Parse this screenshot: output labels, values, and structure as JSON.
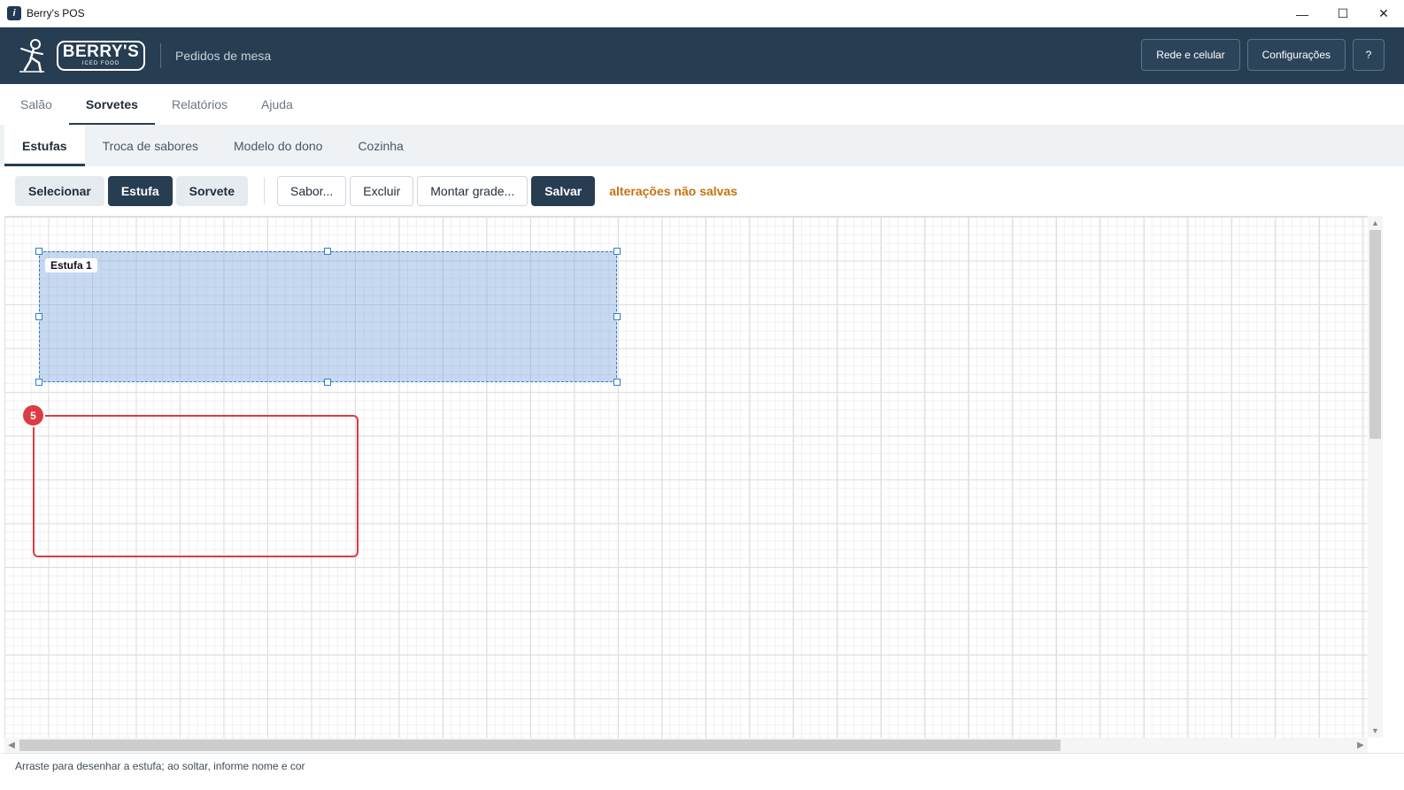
{
  "window": {
    "title": "Berry's POS",
    "icon": "app-icon",
    "controls": {
      "minimize": "—",
      "maximize": "☐",
      "close": "✕"
    }
  },
  "header": {
    "logo_name": "BERRY'S",
    "logo_sub": "ICED FOOD",
    "subtitle": "Pedidos de mesa",
    "actions": {
      "network": "Rede e celular",
      "settings": "Configurações",
      "help": "?"
    },
    "bg_color": "#263d52"
  },
  "main_tabs": [
    {
      "label": "Salão",
      "active": false
    },
    {
      "label": "Sorvetes",
      "active": true
    },
    {
      "label": "Relatórios",
      "active": false
    },
    {
      "label": "Ajuda",
      "active": false
    }
  ],
  "sub_tabs": [
    {
      "label": "Estufas",
      "active": true
    },
    {
      "label": "Troca de sabores",
      "active": false
    },
    {
      "label": "Modelo do dono",
      "active": false
    },
    {
      "label": "Cozinha",
      "active": false
    }
  ],
  "toolbar": {
    "modes": {
      "select": "Selecionar",
      "estufa": "Estufa",
      "sorvete": "Sorvete",
      "active": "Estufa"
    },
    "actions": {
      "flavor": "Sabor...",
      "delete": "Excluir",
      "grid": "Montar grade...",
      "save": "Salvar"
    },
    "unsaved_text": "alterações não salvas",
    "unsaved_color": "#c7720f"
  },
  "canvas": {
    "estufa": {
      "label": "Estufa 1",
      "selected": true
    },
    "draft": {
      "badge": "5",
      "color": "#dd3b42"
    }
  },
  "statusbar": {
    "text": "Arraste para desenhar a estufa; ao soltar, informe nome e cor"
  }
}
